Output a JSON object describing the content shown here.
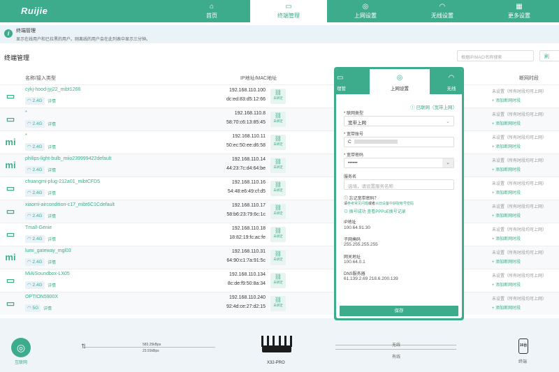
{
  "brand": "Ruijie",
  "nav": {
    "tabs": [
      {
        "label": "首页",
        "icon": "home-icon",
        "glyph": "⌂"
      },
      {
        "label": "终端管理",
        "icon": "devices-icon",
        "glyph": "▭"
      },
      {
        "label": "上网设置",
        "icon": "globe-icon",
        "glyph": "◎"
      },
      {
        "label": "无线设置",
        "icon": "wifi-icon",
        "glyph": "◠"
      },
      {
        "label": "更多设置",
        "icon": "grid-icon",
        "glyph": "▦"
      }
    ],
    "active": "终端管理"
  },
  "notice": {
    "title": "终端管理",
    "desc": "显示在线用户和已拉黑的用户。刚离线的用户会在此列表中显示三分钟。"
  },
  "section_title": "终端管理",
  "search": {
    "placeholder": "根据IP/MAC/名称搜索"
  },
  "refresh_label": "刷",
  "table": {
    "col_name": "名称/接入类型",
    "col_ip": "IP地址/MAC地址",
    "col_time": "断网时段",
    "rows": [
      {
        "name": "cykj-hood-jyj22_mibt1266",
        "icon": "monitor-icon",
        "glyph": "▭",
        "band": "2.4G",
        "ip": "192.168.110.100",
        "mac": "dc:ed:83:d5:12:66"
      },
      {
        "name": "*",
        "icon": "monitor-icon",
        "glyph": "▭",
        "band": "2.4G",
        "ip": "192.168.110.8",
        "mac": "58:70:c6:13:85:45"
      },
      {
        "name": "*",
        "icon": "mi-icon",
        "glyph": "mi",
        "band": "2.4G",
        "ip": "192.168.110.11",
        "mac": "50:ec:50:ee:d6:58"
      },
      {
        "name": "philips-light-bulb_miio239999422default",
        "icon": "mi-icon",
        "glyph": "mi",
        "band": "2.4G",
        "ip": "192.168.110.14",
        "mac": "44:23:7c:d4:64:be"
      },
      {
        "name": "chuangmi-plug-212a01_mibtCFD5",
        "icon": "monitor-icon",
        "glyph": "▭",
        "band": "2.4G",
        "ip": "192.168.110.16",
        "mac": "54:48:e6:49:cf:d5"
      },
      {
        "name": "xiaomi-aircondition-c17_mibt6C1Cdefault",
        "icon": "monitor-icon",
        "glyph": "▭",
        "band": "2.4G",
        "ip": "192.168.110.17",
        "mac": "58:b6:23:79:6c:1c"
      },
      {
        "name": "Tmall-Genie",
        "icon": "monitor-icon",
        "glyph": "▭",
        "band": "2.4G",
        "ip": "192.168.110.18",
        "mac": "18:82:19:fc:ac:fe"
      },
      {
        "name": "lumi_gateway_mgl03",
        "icon": "mi-icon",
        "glyph": "mi",
        "band": "2.4G",
        "ip": "192.168.110.31",
        "mac": "64:90:c1:7a:91:5c"
      },
      {
        "name": "MiAiSoundbox-LX05",
        "icon": "monitor-icon",
        "glyph": "▭",
        "band": "2.4G",
        "ip": "192.168.110.134",
        "mac": "8c:de:f9:50:8a:34"
      },
      {
        "name": "OPTION5900X",
        "icon": "monitor-icon",
        "glyph": "▭",
        "band": "5G",
        "ip": "192.168.110.240",
        "mac": "92:4d:ce:27:d2:15"
      }
    ],
    "detail_label": "详情",
    "bind_label": "未绑定",
    "time_label": "未设置（所有时段均可上网）",
    "add_label": "+ 添加断网时段"
  },
  "footer": {
    "internet_label": "互联网",
    "up_speed": "583.25kBps",
    "down_speed": "23.91kBps",
    "router_label": "X32-PRO",
    "wifi_label": "无线",
    "wired_label": "有线",
    "phone_count": "16台",
    "phone_label": "终端"
  },
  "modal": {
    "tabs": [
      "理管",
      "上网设置",
      "无线"
    ],
    "status": "已联网（宽带上网）",
    "conn_type_label": "* 联网类型",
    "conn_type_value": "宽带上网",
    "account_label": "* 宽带账号",
    "account_value": "C",
    "password_label": "* 宽带密码",
    "password_value": "••••••",
    "service_label": "服务名",
    "service_placeholder": "选填，请设置服务名称",
    "forgot_q": "忘记宽带密码？",
    "forgot_pre": "请",
    "forgot_link": "参考常见问题",
    "forgot_mid": "或者",
    "forgot_link2": "从旧设备中获取帐号密码",
    "dial_success": "拨号成功",
    "view_log": "查看PPPoE拨号记录",
    "ip_label": "IP地址",
    "ip_value": "100.64.91.30",
    "mask_label": "子网掩码",
    "mask_value": "255.255.255.255",
    "gw_label": "网关地址",
    "gw_value": "100.64.0.1",
    "dns_label": "DNS服务器",
    "dns_value": "61.139.2.69 218.6.200.139",
    "save_label": "保存"
  }
}
